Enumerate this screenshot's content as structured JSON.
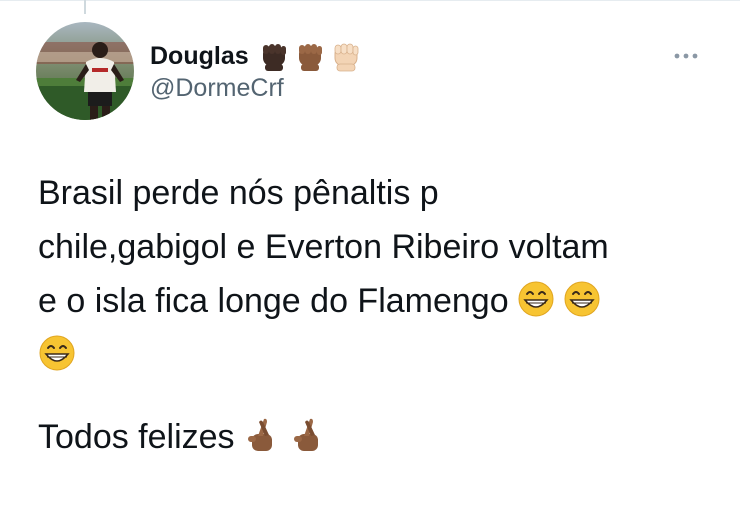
{
  "tweet": {
    "author": {
      "display_name": "Douglas",
      "handle": "@DormeCrf",
      "name_emojis": [
        "raised-fist-dark-skin-icon",
        "raised-fist-medium-dark-skin-icon",
        "raised-fist-light-skin-icon"
      ]
    },
    "more_icon": "more-options-icon",
    "text_lines": [
      "Brasil perde nós pênaltis p",
      "chile,gabigol e Everton Ribeiro voltam",
      "e o isla fica longe do Flamengo"
    ],
    "second_paragraph": "Todos felizes",
    "line3_emojis": [
      "grinning-face-icon",
      "grinning-face-icon"
    ],
    "line4_emojis": [
      "grinning-face-icon"
    ],
    "line5_emojis": [
      "crossed-fingers-medium-dark-icon",
      "crossed-fingers-medium-dark-icon"
    ]
  },
  "colors": {
    "text_primary": "#0f1419",
    "text_secondary": "#536471",
    "border": "#e6ecf0",
    "skin_dark": "#3d2b24",
    "skin_medium_dark": "#8a5a3b",
    "skin_light": "#f3d4b5",
    "emoji_yellow": "#f7c432"
  }
}
